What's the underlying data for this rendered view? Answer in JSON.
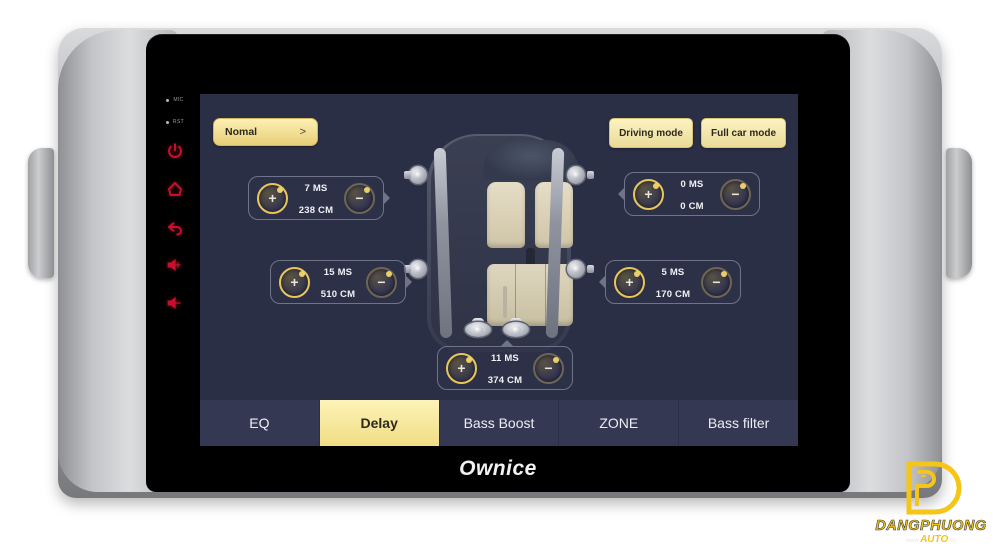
{
  "device": {
    "brand": "Ownice",
    "hardkeys": [
      {
        "name": "mic-label",
        "label": "MIC"
      },
      {
        "name": "rst-label",
        "label": "RST"
      },
      {
        "name": "power-icon",
        "label": "Power"
      },
      {
        "name": "home-icon",
        "label": "Home"
      },
      {
        "name": "back-icon",
        "label": "Back"
      },
      {
        "name": "volume-up-icon",
        "label": "Volume Up"
      },
      {
        "name": "volume-down-icon",
        "label": "Volume Down"
      }
    ]
  },
  "screen": {
    "mode_pill": {
      "label": "Nomal",
      "chevron": ">"
    },
    "top_buttons": [
      {
        "label": "Driving mode",
        "active": false
      },
      {
        "label": "Full car mode",
        "active": false
      }
    ],
    "delay_controls": [
      {
        "position": "front-left",
        "ms": "7 MS",
        "cm": "238 CM",
        "plus": "+",
        "minus": "−"
      },
      {
        "position": "front-right",
        "ms": "0 MS",
        "cm": "0 CM",
        "plus": "+",
        "minus": "−"
      },
      {
        "position": "rear-left",
        "ms": "15 MS",
        "cm": "510 CM",
        "plus": "+",
        "minus": "−"
      },
      {
        "position": "rear-right",
        "ms": "5 MS",
        "cm": "170 CM",
        "plus": "+",
        "minus": "−"
      },
      {
        "position": "subwoofer",
        "ms": "11 MS",
        "cm": "374 CM",
        "plus": "+",
        "minus": "−"
      }
    ],
    "tabs": [
      {
        "label": "EQ",
        "active": false
      },
      {
        "label": "Delay",
        "active": true
      },
      {
        "label": "Bass Boost",
        "active": false
      },
      {
        "label": "ZONE",
        "active": false
      },
      {
        "label": "Bass filter",
        "active": false
      }
    ]
  },
  "watermark": {
    "monogram": "DP",
    "line1": "DANGPHUONG",
    "line2": "AUTO",
    "prefix": "www.",
    "suffix": ".vn"
  },
  "colors": {
    "screen_bg": "#2b2f45",
    "accent_yellow": "#f0dd84",
    "tabbar_bg": "#343852",
    "key_red": "#c8102e",
    "watermark_yellow": "#f5c518"
  }
}
